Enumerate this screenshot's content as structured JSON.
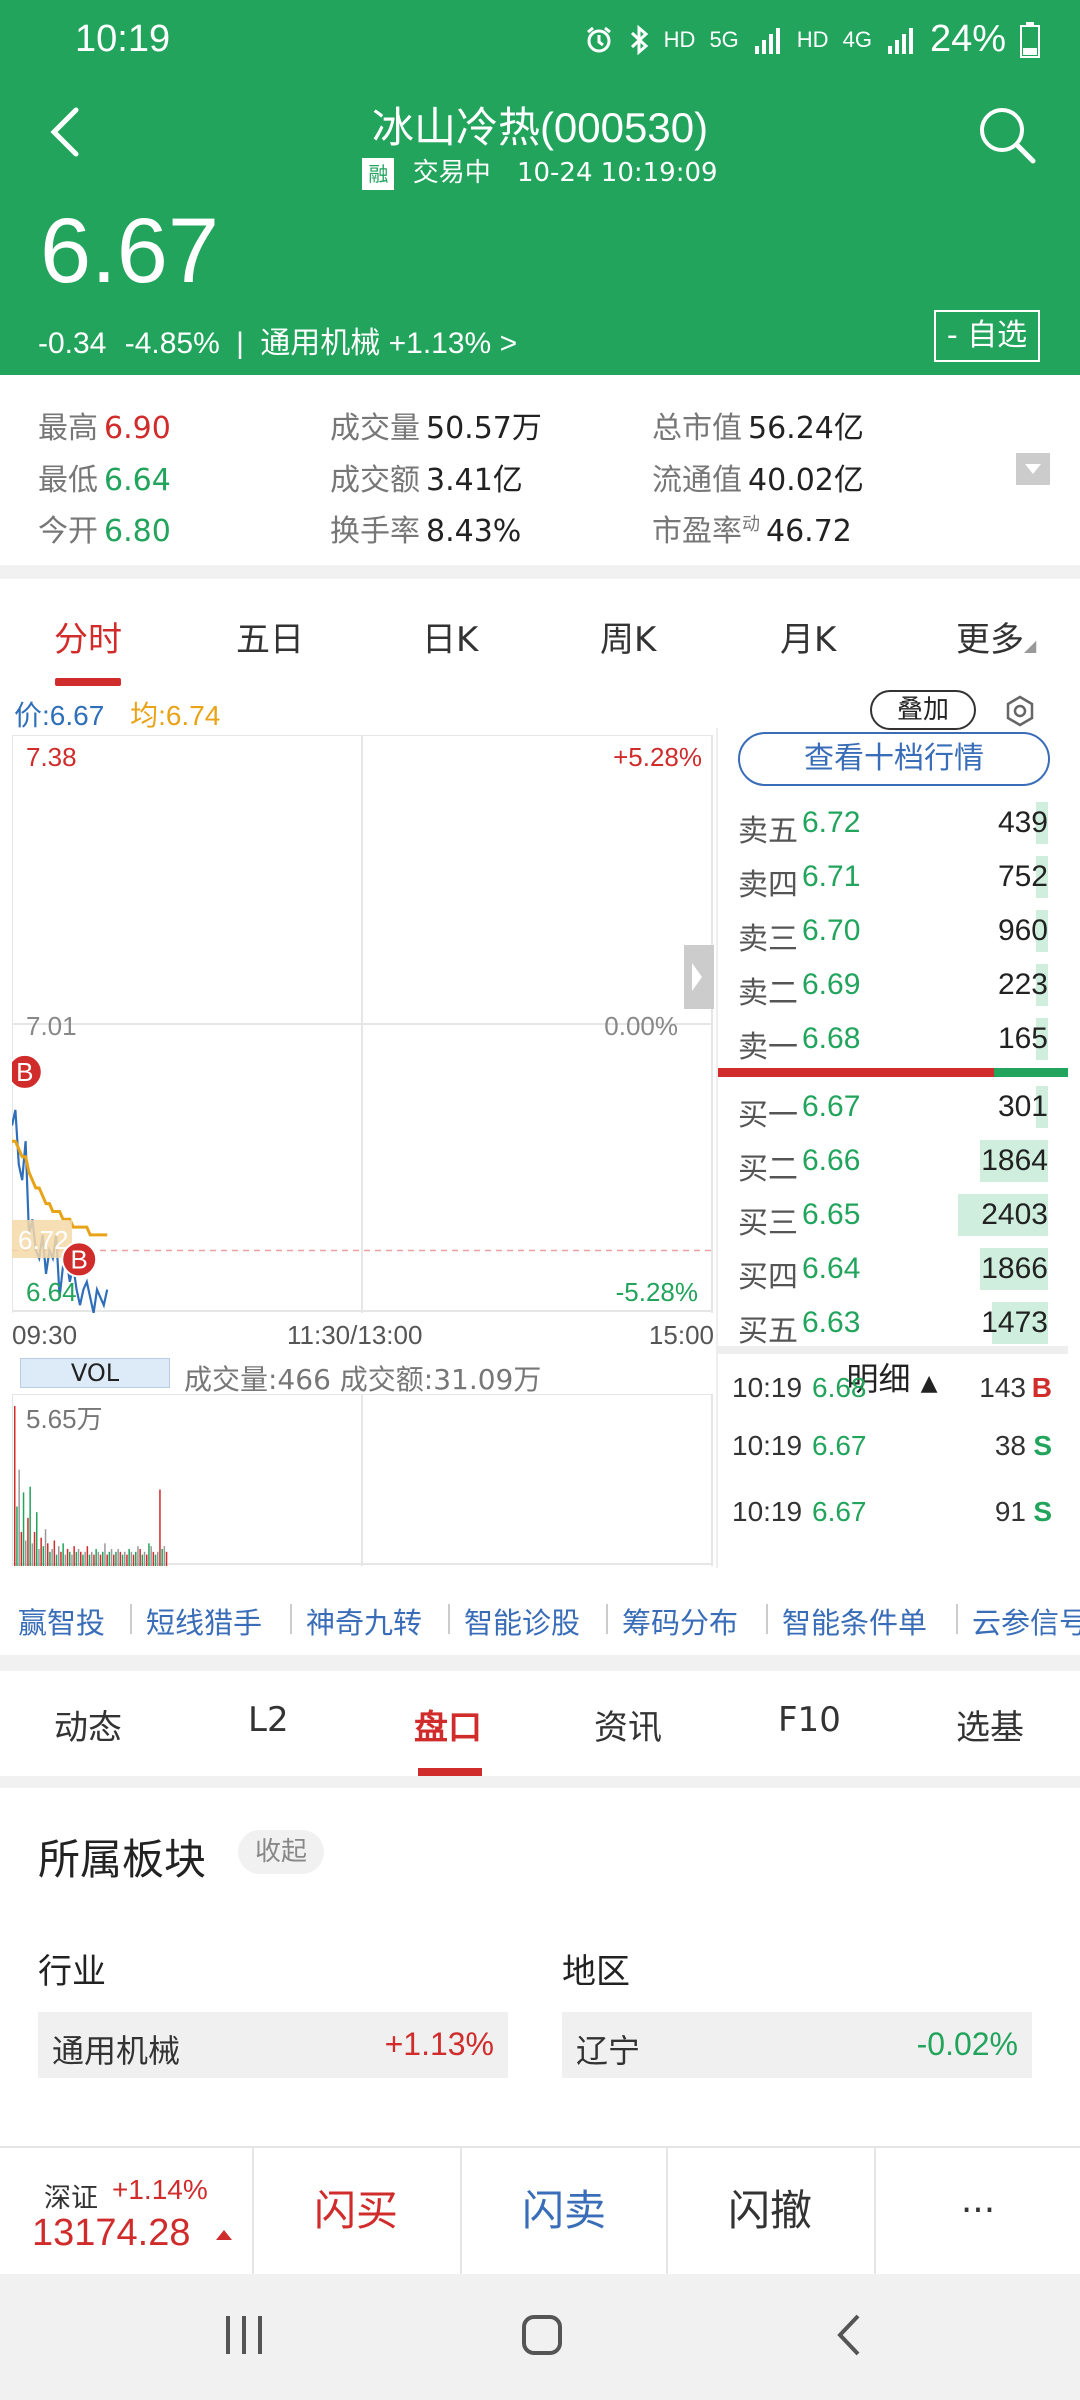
{
  "status_bar": {
    "time": "10:19",
    "hd1": "HD",
    "net1": "5G",
    "hd2": "HD",
    "net2": "4G",
    "battery": "24%"
  },
  "header": {
    "title": "冰山冷热(000530)",
    "margin_badge": "融",
    "trade_status": "交易中",
    "datetime": "10-24 10:19:09",
    "price": "6.67",
    "change": "-0.34",
    "change_pct": "-4.85%",
    "sector_sep": "|",
    "sector": "通用机械",
    "sector_change": "+1.13%",
    "sector_arrow": ">",
    "watch_label": "- 自选"
  },
  "stats": {
    "high_label": "最高",
    "high": "6.90",
    "low_label": "最低",
    "low": "6.64",
    "open_label": "今开",
    "open": "6.80",
    "volume_label": "成交量",
    "volume": "50.57万",
    "amount_label": "成交额",
    "amount": "3.41亿",
    "turnover_label": "换手率",
    "turnover": "8.43%",
    "mcap_label": "总市值",
    "mcap": "56.24亿",
    "float_label": "流通值",
    "float": "40.02亿",
    "pe_label": "市盈率",
    "pe_sup": "动",
    "pe": "46.72"
  },
  "chart_tabs": [
    "分时",
    "五日",
    "日K",
    "周K",
    "月K",
    "更多"
  ],
  "chart_legend": {
    "price_label": "价:6.67",
    "avg_label": "均:6.74",
    "overlay": "叠加"
  },
  "chart_data": {
    "type": "line",
    "y_high": "7.38",
    "y_mid": "7.01",
    "y_low": "6.64",
    "pct_high": "+5.28%",
    "pct_mid": "0.00%",
    "pct_low": "-5.28%",
    "current_tag": "6.72",
    "x_labels": [
      "09:30",
      "11:30/13:00",
      "15:00"
    ],
    "ylim": [
      6.64,
      7.38
    ],
    "prev_close": 7.01,
    "series": [
      {
        "values": [
          6.88,
          6.9,
          6.83,
          6.81,
          6.86,
          6.74,
          6.76,
          6.72,
          6.71,
          6.74,
          6.69,
          6.72,
          6.71,
          6.74,
          6.66,
          6.7,
          6.71,
          6.68,
          6.7,
          6.67,
          6.65,
          6.67,
          6.68,
          6.66,
          6.64,
          6.67,
          6.66,
          6.65,
          6.67
        ]
      },
      {
        "values": [
          6.86,
          6.86,
          6.85,
          6.84,
          6.84,
          6.82,
          6.81,
          6.8,
          6.8,
          6.79,
          6.78,
          6.78,
          6.77,
          6.77,
          6.77,
          6.76,
          6.76,
          6.76,
          6.75,
          6.75,
          6.75,
          6.75,
          6.75,
          6.74,
          6.74,
          6.74,
          6.74,
          6.74,
          6.74
        ]
      }
    ],
    "trade_markers": [
      "B",
      "B"
    ],
    "volume": {
      "label": "VOL",
      "summary": "成交量:466 成交额:31.09万",
      "max_label": "5.65万",
      "values": [
        5.65,
        2.1,
        3.4,
        1.2,
        2.6,
        0.9,
        1.7,
        2.8,
        0.8,
        1.2,
        1.9,
        0.6,
        1.0,
        0.7,
        1.3,
        0.8,
        0.5,
        0.6,
        0.9,
        0.4,
        0.7,
        0.5,
        0.8,
        0.4,
        0.6,
        0.5,
        0.4,
        0.7,
        0.5,
        0.6,
        0.5,
        0.4,
        0.5,
        0.7,
        0.4,
        0.5,
        0.4,
        0.6,
        0.5,
        0.4,
        0.5,
        0.8,
        0.4,
        0.5,
        0.6,
        0.4,
        0.5,
        0.6,
        0.5,
        0.4,
        0.5,
        0.4,
        0.6,
        0.5,
        0.4,
        0.5,
        0.7,
        0.6,
        0.4,
        0.5,
        0.4,
        0.8,
        0.7,
        0.5,
        0.4,
        0.5,
        2.7,
        0.6,
        0.7,
        0.5
      ]
    }
  },
  "order_book": {
    "btn_label": "查看十档行情",
    "asks": [
      {
        "label": "卖五",
        "price": "6.72",
        "volume": "439",
        "ratio": 0.07
      },
      {
        "label": "卖四",
        "price": "6.71",
        "volume": "752",
        "ratio": 0.12
      },
      {
        "label": "卖三",
        "price": "6.70",
        "volume": "960",
        "ratio": 0.05
      },
      {
        "label": "卖二",
        "price": "6.69",
        "volume": "223",
        "ratio": 0.02
      },
      {
        "label": "卖一",
        "price": "6.68",
        "volume": "165",
        "ratio": 0.02
      }
    ],
    "bids": [
      {
        "label": "买一",
        "price": "6.67",
        "volume": "301",
        "ratio": 0.03
      },
      {
        "label": "买二",
        "price": "6.66",
        "volume": "1864",
        "ratio": 0.76
      },
      {
        "label": "买三",
        "price": "6.65",
        "volume": "2403",
        "ratio": 1.0
      },
      {
        "label": "买四",
        "price": "6.64",
        "volume": "1866",
        "ratio": 0.76
      },
      {
        "label": "买五",
        "price": "6.63",
        "volume": "1473",
        "ratio": 0.62
      }
    ],
    "buy_ratio": 0.79,
    "detail_label": "明细",
    "trades": [
      {
        "time": "10:19",
        "price": "6.68",
        "vol": "143",
        "side": "B"
      },
      {
        "time": "10:19",
        "price": "6.67",
        "vol": "38",
        "side": "S"
      },
      {
        "time": "10:19",
        "price": "6.67",
        "vol": "91",
        "side": "S"
      }
    ]
  },
  "tools": [
    "赢智投",
    "短线猎手",
    "神奇九转",
    "智能诊股",
    "筹码分布",
    "智能条件单",
    "云参信号"
  ],
  "bottom_tabs": [
    "动态",
    "L2",
    "盘口",
    "资讯",
    "F10",
    "选基"
  ],
  "sectors": {
    "title": "所属板块",
    "collapse": "收起",
    "industry_label": "行业",
    "industry_name": "通用机械",
    "industry_change": "+1.13%",
    "region_label": "地区",
    "region_name": "辽宁",
    "region_change": "-0.02%"
  },
  "action_bar": {
    "index_name": "深证",
    "index_change": "+1.14%",
    "index_value": "13174.28",
    "buy": "闪买",
    "sell": "闪卖",
    "cancel": "闪撤",
    "more": "···"
  },
  "colors": {
    "brand_green": "#22a45c",
    "up_red": "#d02c2c",
    "link_blue": "#3a6db8",
    "avg_orange": "#e8a317",
    "price_blue": "#2f6fba"
  }
}
